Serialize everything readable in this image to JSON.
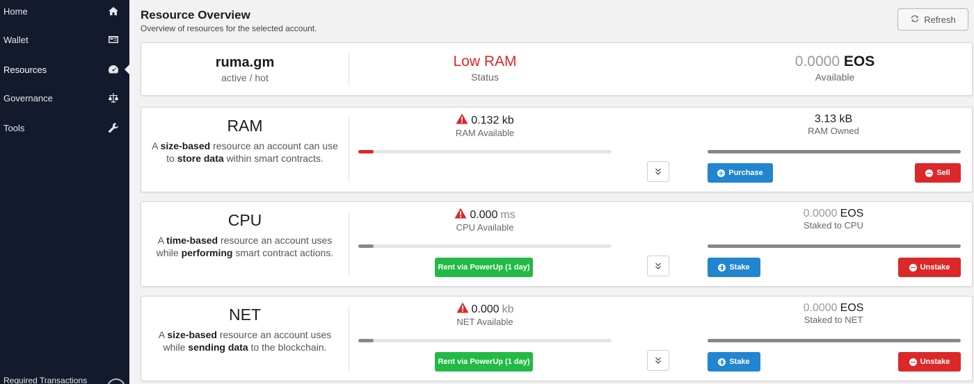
{
  "sidebar": {
    "items": [
      {
        "label": "Home",
        "icon": "home-icon"
      },
      {
        "label": "Wallet",
        "icon": "wallet-icon"
      },
      {
        "label": "Resources",
        "icon": "dashboard-icon"
      },
      {
        "label": "Governance",
        "icon": "balance-scale-icon"
      },
      {
        "label": "Tools",
        "icon": "wrench-icon"
      }
    ],
    "active_item": "Resources",
    "footer_label": "Required Transactions"
  },
  "header": {
    "title": "Resource Overview",
    "subtitle": "Overview of resources for the selected account.",
    "refresh_label": "Refresh"
  },
  "summary": {
    "account_name": "ruma.gm",
    "permission": "active / hot",
    "status_value": "Low RAM",
    "status_label": "Status",
    "balance_amount": "0.0000",
    "balance_symbol": "EOS",
    "balance_label": "Available"
  },
  "resources": {
    "ram": {
      "name": "RAM",
      "desc_pre": "A",
      "desc_b1": "size-based",
      "desc_mid": "resource an account can use to",
      "desc_b2": "store data",
      "desc_post": "within smart contracts.",
      "available_value": "0.132 kb",
      "available_label": "RAM Available",
      "available_fraction": 0.06,
      "owned_value": "3.13 kB",
      "owned_label": "RAM Owned",
      "owned_fraction": 1.0,
      "buy_label": "Purchase",
      "sell_label": "Sell"
    },
    "cpu": {
      "name": "CPU",
      "desc_pre": "A",
      "desc_b1": "time-based",
      "desc_mid": "resource an account uses while",
      "desc_b2": "performing",
      "desc_post": "smart contract actions.",
      "available_number": "0.000",
      "available_unit": "ms",
      "available_label": "CPU Available",
      "available_fraction": 0.06,
      "staked_amount": "0.0000",
      "staked_symbol": "EOS",
      "staked_label": "Staked to CPU",
      "staked_fraction": 1.0,
      "rent_label": "Rent via PowerUp (1 day)",
      "stake_label": "Stake",
      "unstake_label": "Unstake"
    },
    "net": {
      "name": "NET",
      "desc_pre": "A",
      "desc_b1": "size-based",
      "desc_mid": "resource an account uses while",
      "desc_b2": "sending data",
      "desc_post": "to the blockchain.",
      "available_number": "0.000",
      "available_unit": "kb",
      "available_label": "NET Available",
      "available_fraction": 0.06,
      "staked_amount": "0.0000",
      "staked_symbol": "EOS",
      "staked_label": "Staked to NET",
      "staked_fraction": 1.0,
      "rent_label": "Rent via PowerUp (1 day)",
      "stake_label": "Stake",
      "unstake_label": "Unstake"
    }
  },
  "colors": {
    "sidebar_bg": "#141a2e",
    "low_ram_red": "#db2828",
    "primary_blue": "#2185d0",
    "success_green": "#21ba45",
    "bar_track": "#e4e4e4",
    "bar_used_red": "#db2828",
    "bar_used_grey": "#888888"
  }
}
